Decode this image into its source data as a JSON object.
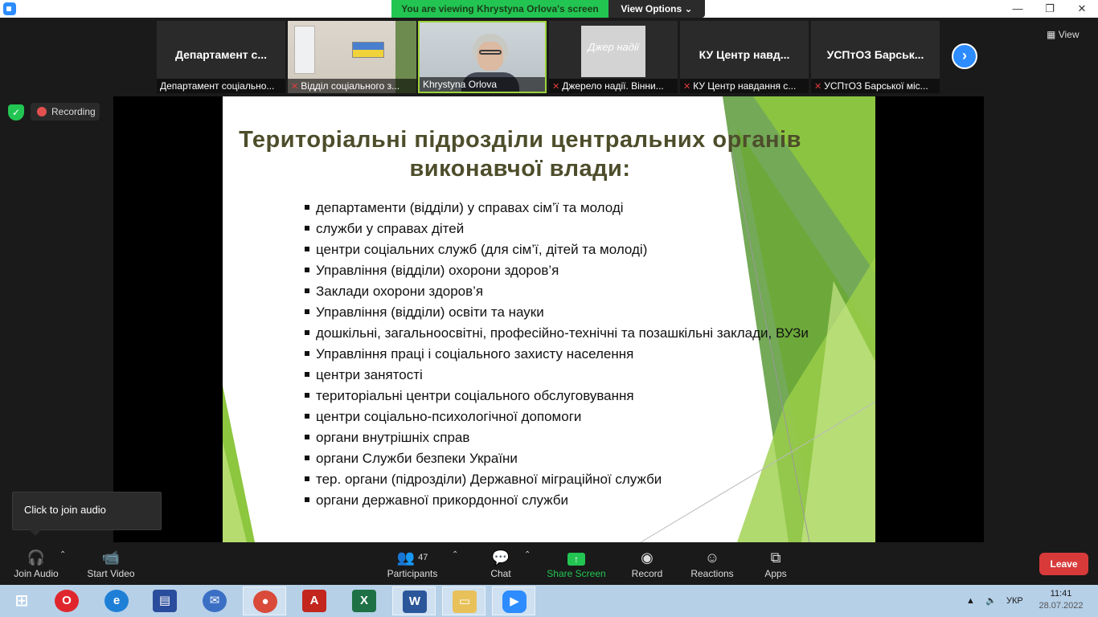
{
  "titlebar": {
    "viewing_banner": "You are viewing Khrystyna Orlova's screen",
    "view_options": "View Options",
    "minimize": "—",
    "restore": "❐",
    "close": "✕"
  },
  "strip": {
    "view_label": "View",
    "tiles": [
      {
        "center": "Департамент с...",
        "label": "Департамент соціально...",
        "muted": false
      },
      {
        "center": "",
        "label": "Відділ соціального з...",
        "muted": true
      },
      {
        "center": "",
        "label": "Khrystyna Orlova",
        "muted": false
      },
      {
        "center": "",
        "label": "Джерело надії. Вінни...",
        "muted": true,
        "logo_text": "Джер надії"
      },
      {
        "center": "КУ Центр навд...",
        "label": "КУ Центр навдання с...",
        "muted": true
      },
      {
        "center": "УСПтОЗ Барськ...",
        "label": "УСПтОЗ Барської міс...",
        "muted": true
      }
    ]
  },
  "status": {
    "recording": "Recording"
  },
  "slide": {
    "title": "Територіальні підрозділи центральних органів виконавчої влади:",
    "bullets": [
      "департаменти (відділи) у справах сім’ї та  молоді",
      "служби у справах дітей",
      "центри соціальних служб (для сім’ї, дітей  та  молоді)",
      "Управління (відділи) охорони здоров’я",
      "Заклади охорони здоров’я",
      "Управління (відділи) освіти та науки",
      "дошкільні, загальноосвітні, професійно-технічні   та позашкільні заклади, ВУЗи",
      "Управління  праці і  соціального  захисту населення",
      "центри занятості",
      "територіальні центри соціального обслуговування",
      "центри соціально-психологічної допомоги",
      "органи внутрішніх справ",
      "органи Служби безпеки України",
      "тер. органи (підрозділи) Державної міграційної служби",
      "органи державної прикордонної служби"
    ]
  },
  "tooltip": {
    "text": "Click to join audio"
  },
  "toolbar": {
    "join_audio": "Join Audio",
    "start_video": "Start Video",
    "participants": "Participants",
    "participants_count": "47",
    "chat": "Chat",
    "share_screen": "Share Screen",
    "record": "Record",
    "reactions": "Reactions",
    "apps": "Apps",
    "leave": "Leave"
  },
  "taskbar": {
    "apps": [
      "windows-start",
      "opera",
      "internet-explorer",
      "save-disk",
      "thunderbird",
      "chrome",
      "acrobat",
      "excel",
      "word",
      "explorer",
      "zoom"
    ],
    "language": "УКР",
    "time": "11:41",
    "date": "28.07.2022"
  },
  "colors": {
    "zoom_green": "#23c552",
    "zoom_blue": "#2d8cff",
    "leave_red": "#d83a3a",
    "slide_title": "#4d4d2b",
    "slide_green": "#8dc63f"
  }
}
